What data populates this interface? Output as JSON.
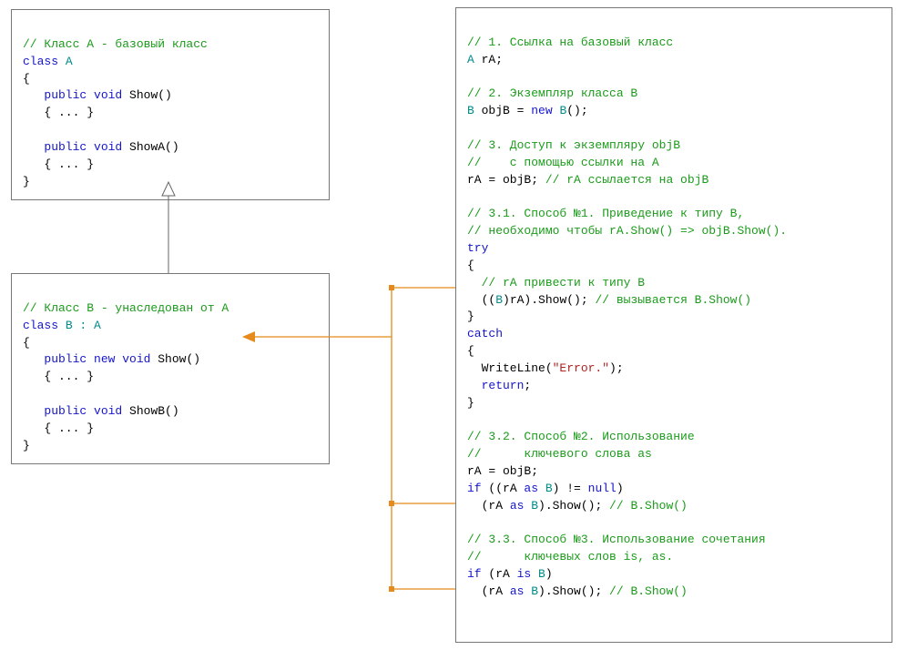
{
  "boxA": {
    "l1": "// Класс A - базовый класс",
    "l2a": "class",
    "l2b": " A",
    "l3": "{",
    "l4a": "   public",
    "l4b": " void",
    "l4c": " Show()",
    "l5": "   { ... }",
    "l6": "",
    "l7a": "   public",
    "l7b": " void",
    "l7c": " ShowA()",
    "l8": "   { ... }",
    "l9": "}"
  },
  "boxB": {
    "l1": "// Класс B - унаследован от A",
    "l2a": "class",
    "l2b": " B : ",
    "l2c": "A",
    "l3": "{",
    "l4a": "   public",
    "l4b": " new",
    "l4c": " void",
    "l4d": " Show()",
    "l5": "   { ... }",
    "l6": "",
    "l7a": "   public",
    "l7b": " void",
    "l7c": " ShowB()",
    "l8": "   { ... }",
    "l9": "}"
  },
  "boxC": {
    "l01": "// 1. Ссылка на базовый класс",
    "l02a": "A",
    "l02b": " rA;",
    "l03": "",
    "l04": "// 2. Экземпляр класса B",
    "l05a": "B",
    "l05b": " objB = ",
    "l05c": "new",
    "l05d": " B",
    "l05e": "();",
    "l06": "",
    "l07": "// 3. Доступ к экземпляру objB",
    "l08": "//    с помощью ссылки на A",
    "l09a": "rA = objB; ",
    "l09b": "// rA ссылается на objB",
    "l10": "",
    "l11": "// 3.1. Способ №1. Приведение к типу B,",
    "l12": "// необходимо чтобы rA.Show() => objB.Show().",
    "l13": "try",
    "l14": "{",
    "l15": "  // rA привести к типу B",
    "l16a": "  ((",
    "l16b": "B",
    "l16c": ")rA).Show(); ",
    "l16d": "// вызывается B.Show()",
    "l17": "}",
    "l18": "catch",
    "l19": "{",
    "l20a": "  WriteLine(",
    "l20b": "\"Error.\"",
    "l20c": ");",
    "l21a": "  return",
    "l21b": ";",
    "l22": "}",
    "l23": "",
    "l24": "// 3.2. Способ №2. Использование",
    "l25": "//      ключевого слова as",
    "l26": "rA = objB;",
    "l27a": "if",
    "l27b": " ((rA ",
    "l27c": "as",
    "l27d": " B",
    "l27e": ") != ",
    "l27f": "null",
    "l27g": ")",
    "l28a": "  (rA ",
    "l28b": "as",
    "l28c": " B",
    "l28d": ").Show(); ",
    "l28e": "// B.Show()",
    "l29": "",
    "l30": "// 3.3. Способ №3. Использование сочетания",
    "l31": "//      ключевых слов is, as.",
    "l32a": "if",
    "l32b": " (rA ",
    "l32c": "is",
    "l32d": " B",
    "l32e": ")",
    "l33a": "  (rA ",
    "l33b": "as",
    "l33c": " B",
    "l33d": ").Show(); ",
    "l33e": "// B.Show()"
  }
}
